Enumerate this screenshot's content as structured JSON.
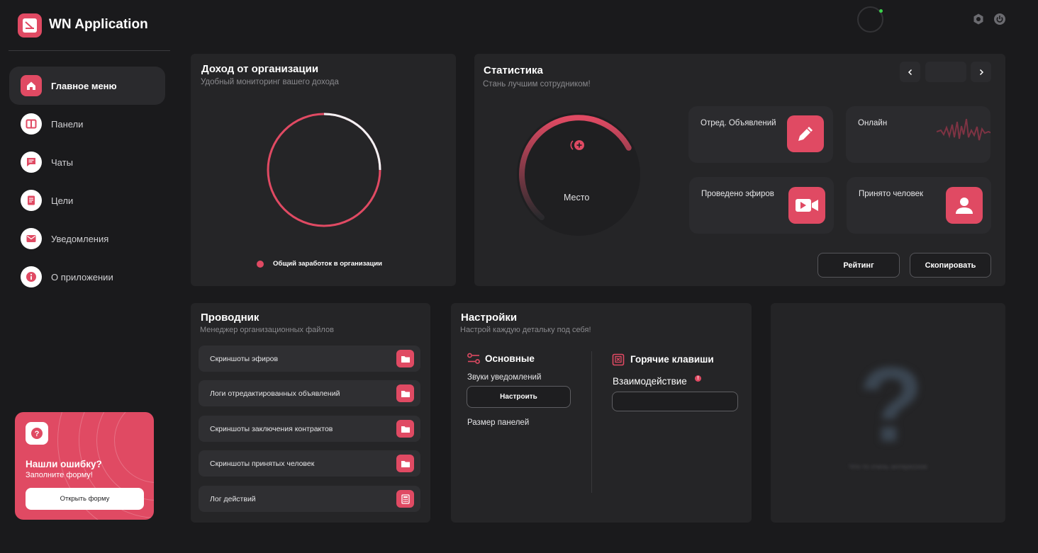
{
  "app": {
    "title": "WN Application"
  },
  "sidebar": {
    "items": [
      {
        "label": "Главное меню",
        "icon": "home-icon"
      },
      {
        "label": "Панели",
        "icon": "panels-icon"
      },
      {
        "label": "Чаты",
        "icon": "chat-icon"
      },
      {
        "label": "Цели",
        "icon": "goals-icon"
      },
      {
        "label": "Уведомления",
        "icon": "mail-icon"
      },
      {
        "label": "О приложении",
        "icon": "info-icon"
      }
    ],
    "active_index": 0
  },
  "promo": {
    "title": "Нашли ошибку?",
    "subtitle": "Заполните форму!",
    "button": "Открыть форму",
    "icon": "question-icon"
  },
  "income": {
    "title": "Доход от организации",
    "subtitle": "Удобный мониторинг вашего дохода",
    "legend_label": "Общий заработок в организации",
    "gauge_fraction": 0.75
  },
  "stats": {
    "title": "Статистика",
    "subtitle": "Стань лучшим сотрудником!",
    "place_label": "Место",
    "tiles": [
      {
        "label": "Отред. Объявлений",
        "icon": "pencil-icon"
      },
      {
        "label": "Онлайн",
        "icon": "activity-wave-icon"
      },
      {
        "label": "Проведено эфиров",
        "icon": "video-icon"
      },
      {
        "label": "Принято человек",
        "icon": "user-icon"
      }
    ],
    "rating_button": "Рейтинг",
    "copy_button": "Скопировать"
  },
  "explorer": {
    "title": "Проводник",
    "subtitle": "Менеджер организационных файлов",
    "files": [
      {
        "label": "Скриншоты эфиров",
        "icon": "folder-icon"
      },
      {
        "label": "Логи отредактированных объявлений",
        "icon": "folder-icon"
      },
      {
        "label": "Скриншоты заключения контрактов",
        "icon": "folder-icon"
      },
      {
        "label": "Скриншоты принятых человек",
        "icon": "folder-icon"
      },
      {
        "label": "Лог действий",
        "icon": "calculator-icon"
      }
    ]
  },
  "settings": {
    "title": "Настройки",
    "subtitle": "Настрой каждую детальку под себя!",
    "basic": {
      "title": "Основные",
      "sounds_label": "Звуки уведомлений",
      "configure_button": "Настроить",
      "panel_size_label": "Размер панелей"
    },
    "hotkeys": {
      "title": "Горячие клавиши",
      "interaction_label": "Взаимодействие",
      "info_mark": "!"
    }
  },
  "mystery": {
    "symbol": "?",
    "text": "Что-то очень интересное"
  },
  "colors": {
    "accent": "#e04a63",
    "background": "#1a1a1c",
    "card": "#252527",
    "online": "#3bd14b"
  }
}
